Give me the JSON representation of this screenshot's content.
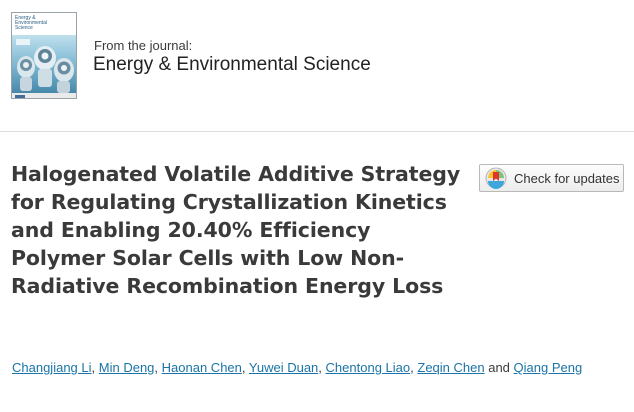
{
  "journal": {
    "cover_title": "Energy & Environmental Science",
    "label": "From the journal:",
    "name": "Energy & Environmental Science"
  },
  "article": {
    "title": "Halogenated Volatile Additive Strategy for Regulating Crystallization Kinetics and Enabling 20.40% Efficiency Polymer Solar Cells with Low Non-Radiative Recombination Energy Loss",
    "authors": [
      "Changjiang Li",
      "Min Deng",
      "Haonan Chen",
      "Yuwei Duan",
      "Chentong Liao",
      "Zeqin Chen",
      "Qiang Peng"
    ],
    "author_separator": ",",
    "author_conjunction": "and"
  },
  "check_updates": {
    "label": "Check for updates",
    "icon": "crossmark-icon"
  },
  "colors": {
    "link": "#1b74a8",
    "title": "#3a3a3a"
  }
}
